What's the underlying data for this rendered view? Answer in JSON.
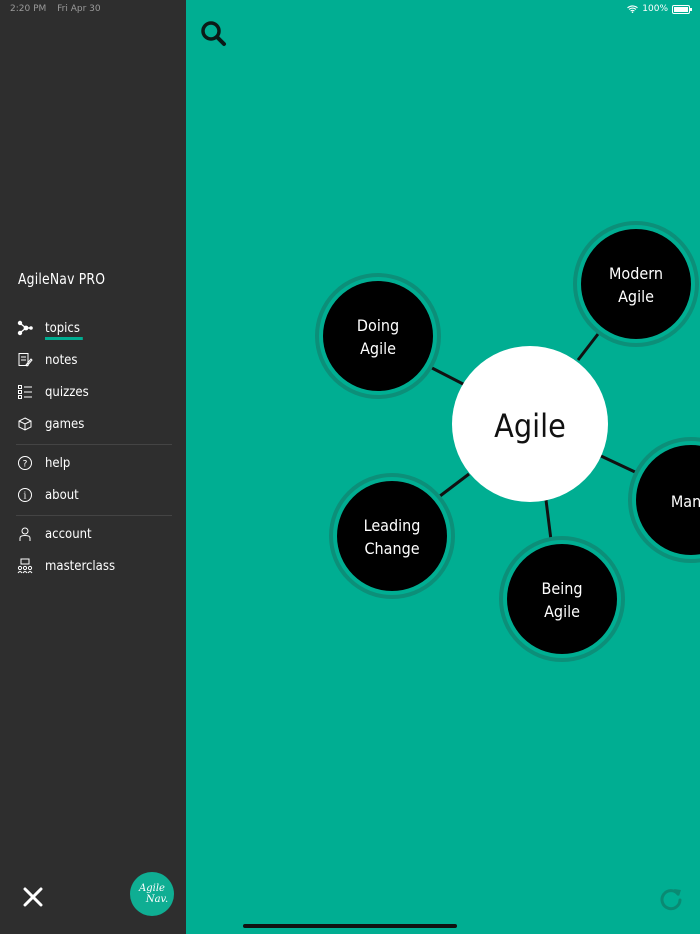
{
  "status": {
    "time": "2:20 PM",
    "date": "Fri Apr 30",
    "battery": "100%"
  },
  "sidebar": {
    "title": "AgileNav PRO",
    "items": [
      {
        "label": "topics",
        "icon": "graph-nodes-icon",
        "active": true
      },
      {
        "label": "notes",
        "icon": "note-edit-icon"
      },
      {
        "label": "quizzes",
        "icon": "checklist-icon"
      },
      {
        "label": "games",
        "icon": "game-cube-icon"
      },
      {
        "label": "help",
        "icon": "question-circle-icon"
      },
      {
        "label": "about",
        "icon": "info-circle-icon"
      },
      {
        "label": "account",
        "icon": "person-icon"
      },
      {
        "label": "masterclass",
        "icon": "classroom-icon"
      }
    ],
    "logo_line1": "Agile",
    "logo_line2": "Nav."
  },
  "graph": {
    "center": "Agile",
    "nodes": [
      {
        "line1": "Doing",
        "line2": "Agile"
      },
      {
        "line1": "Modern",
        "line2": "Agile"
      },
      {
        "line1": "Manife",
        "line2": ""
      },
      {
        "line1": "Being",
        "line2": "Agile"
      },
      {
        "line1": "Leading",
        "line2": "Change"
      }
    ]
  },
  "colors": {
    "accent": "#00AE92",
    "sidebar": "#2E2E2E",
    "node": "#000000",
    "ring": "#0C8F79"
  }
}
